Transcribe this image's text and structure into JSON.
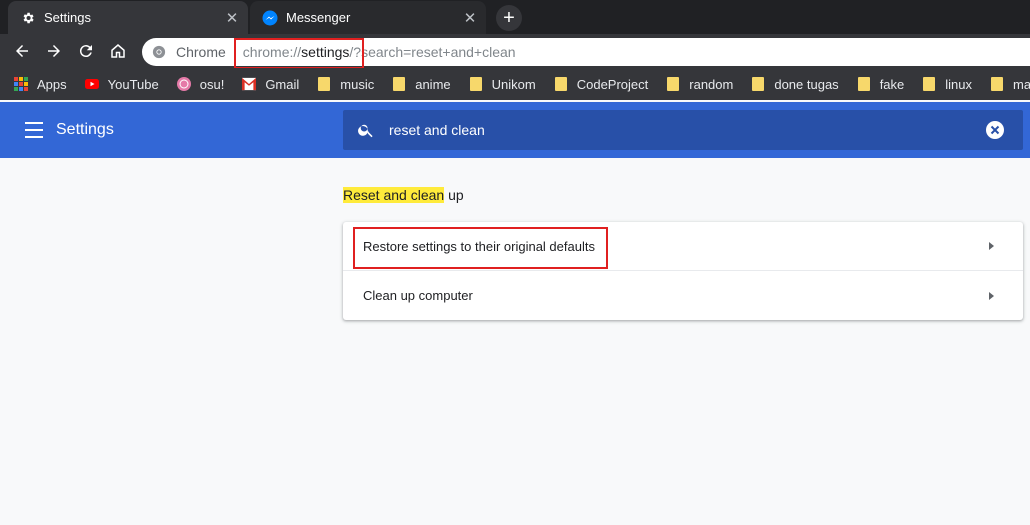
{
  "tabs": [
    {
      "label": "Settings",
      "icon": "gear-icon"
    },
    {
      "label": "Messenger",
      "icon": "messenger-icon"
    }
  ],
  "omnibox": {
    "chip": "Chrome",
    "url_scheme": "chrome://",
    "url_host": "settings",
    "url_rest": "/?search=reset+and+clean"
  },
  "bookmarks": [
    {
      "label": "Apps",
      "icon": "apps-grid-icon"
    },
    {
      "label": "YouTube",
      "icon": "youtube-icon"
    },
    {
      "label": "osu!",
      "icon": "osu-icon"
    },
    {
      "label": "Gmail",
      "icon": "gmail-icon"
    },
    {
      "label": "music",
      "icon": "folder-icon"
    },
    {
      "label": "anime",
      "icon": "folder-icon"
    },
    {
      "label": "Unikom",
      "icon": "folder-icon"
    },
    {
      "label": "CodeProject",
      "icon": "folder-icon"
    },
    {
      "label": "random",
      "icon": "folder-icon"
    },
    {
      "label": "done tugas",
      "icon": "folder-icon"
    },
    {
      "label": "fake",
      "icon": "folder-icon"
    },
    {
      "label": "linux",
      "icon": "folder-icon"
    },
    {
      "label": "maps",
      "icon": "folder-icon"
    }
  ],
  "header": {
    "title": "Settings",
    "search_value": "reset and clean"
  },
  "section": {
    "title_highlight": "Reset and clean",
    "title_rest": " up"
  },
  "card": {
    "rows": [
      {
        "label": "Restore settings to their original defaults"
      },
      {
        "label": "Clean up computer"
      }
    ]
  },
  "colors": {
    "header_bg": "#3367d6",
    "search_bg": "#2850a8",
    "highlight": "#ffeb3b",
    "annotation_red": "#e02020"
  }
}
